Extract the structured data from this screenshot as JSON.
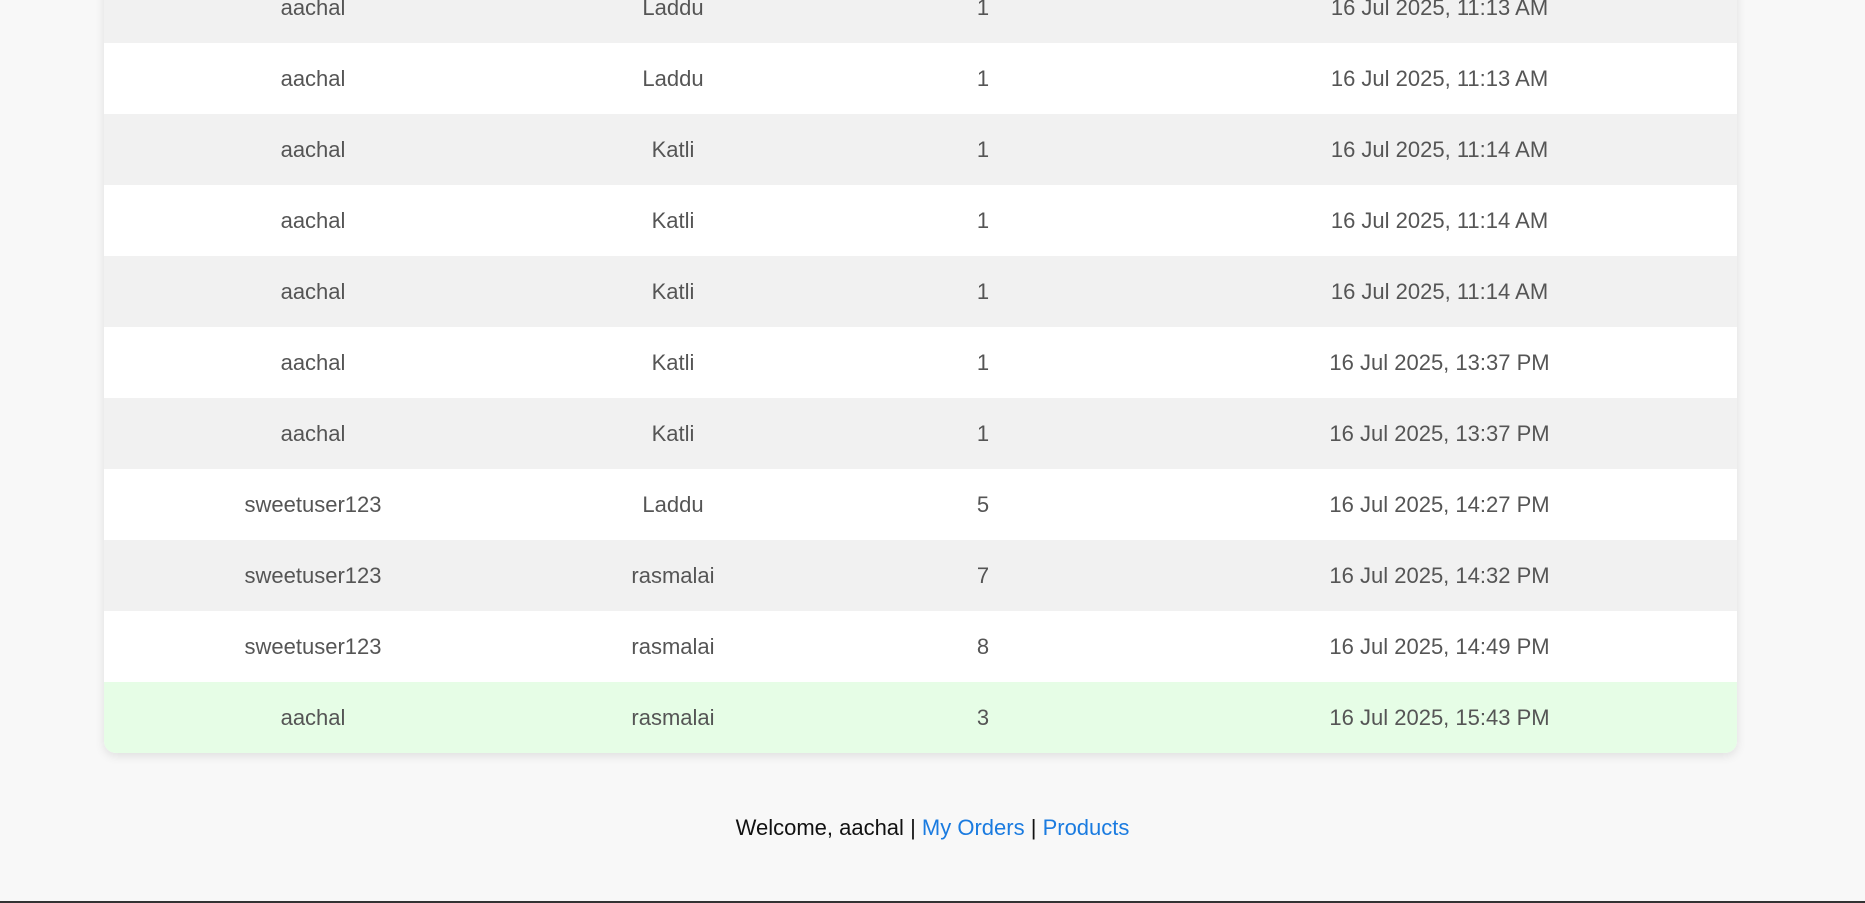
{
  "orders": {
    "rows": [
      {
        "user": "aachal",
        "product": "Laddu",
        "quantity": "1",
        "date": "16 Jul 2025, 11:13 AM",
        "highlight": false
      },
      {
        "user": "aachal",
        "product": "Laddu",
        "quantity": "1",
        "date": "16 Jul 2025, 11:13 AM",
        "highlight": false
      },
      {
        "user": "aachal",
        "product": "Katli",
        "quantity": "1",
        "date": "16 Jul 2025, 11:14 AM",
        "highlight": false
      },
      {
        "user": "aachal",
        "product": "Katli",
        "quantity": "1",
        "date": "16 Jul 2025, 11:14 AM",
        "highlight": false
      },
      {
        "user": "aachal",
        "product": "Katli",
        "quantity": "1",
        "date": "16 Jul 2025, 11:14 AM",
        "highlight": false
      },
      {
        "user": "aachal",
        "product": "Katli",
        "quantity": "1",
        "date": "16 Jul 2025, 13:37 PM",
        "highlight": false
      },
      {
        "user": "aachal",
        "product": "Katli",
        "quantity": "1",
        "date": "16 Jul 2025, 13:37 PM",
        "highlight": false
      },
      {
        "user": "sweetuser123",
        "product": "Laddu",
        "quantity": "5",
        "date": "16 Jul 2025, 14:27 PM",
        "highlight": false
      },
      {
        "user": "sweetuser123",
        "product": "rasmalai",
        "quantity": "7",
        "date": "16 Jul 2025, 14:32 PM",
        "highlight": false
      },
      {
        "user": "sweetuser123",
        "product": "rasmalai",
        "quantity": "8",
        "date": "16 Jul 2025, 14:49 PM",
        "highlight": false
      },
      {
        "user": "aachal",
        "product": "rasmalai",
        "quantity": "3",
        "date": "16 Jul 2025, 15:43 PM",
        "highlight": true
      }
    ]
  },
  "footer": {
    "welcome": "Welcome, aachal",
    "separator": "|",
    "my_orders_link": "My Orders",
    "products_link": "Products"
  },
  "colors": {
    "highlight_row": "#e6fde6",
    "striped_row": "#f1f1f1",
    "link": "#1a7be0"
  }
}
